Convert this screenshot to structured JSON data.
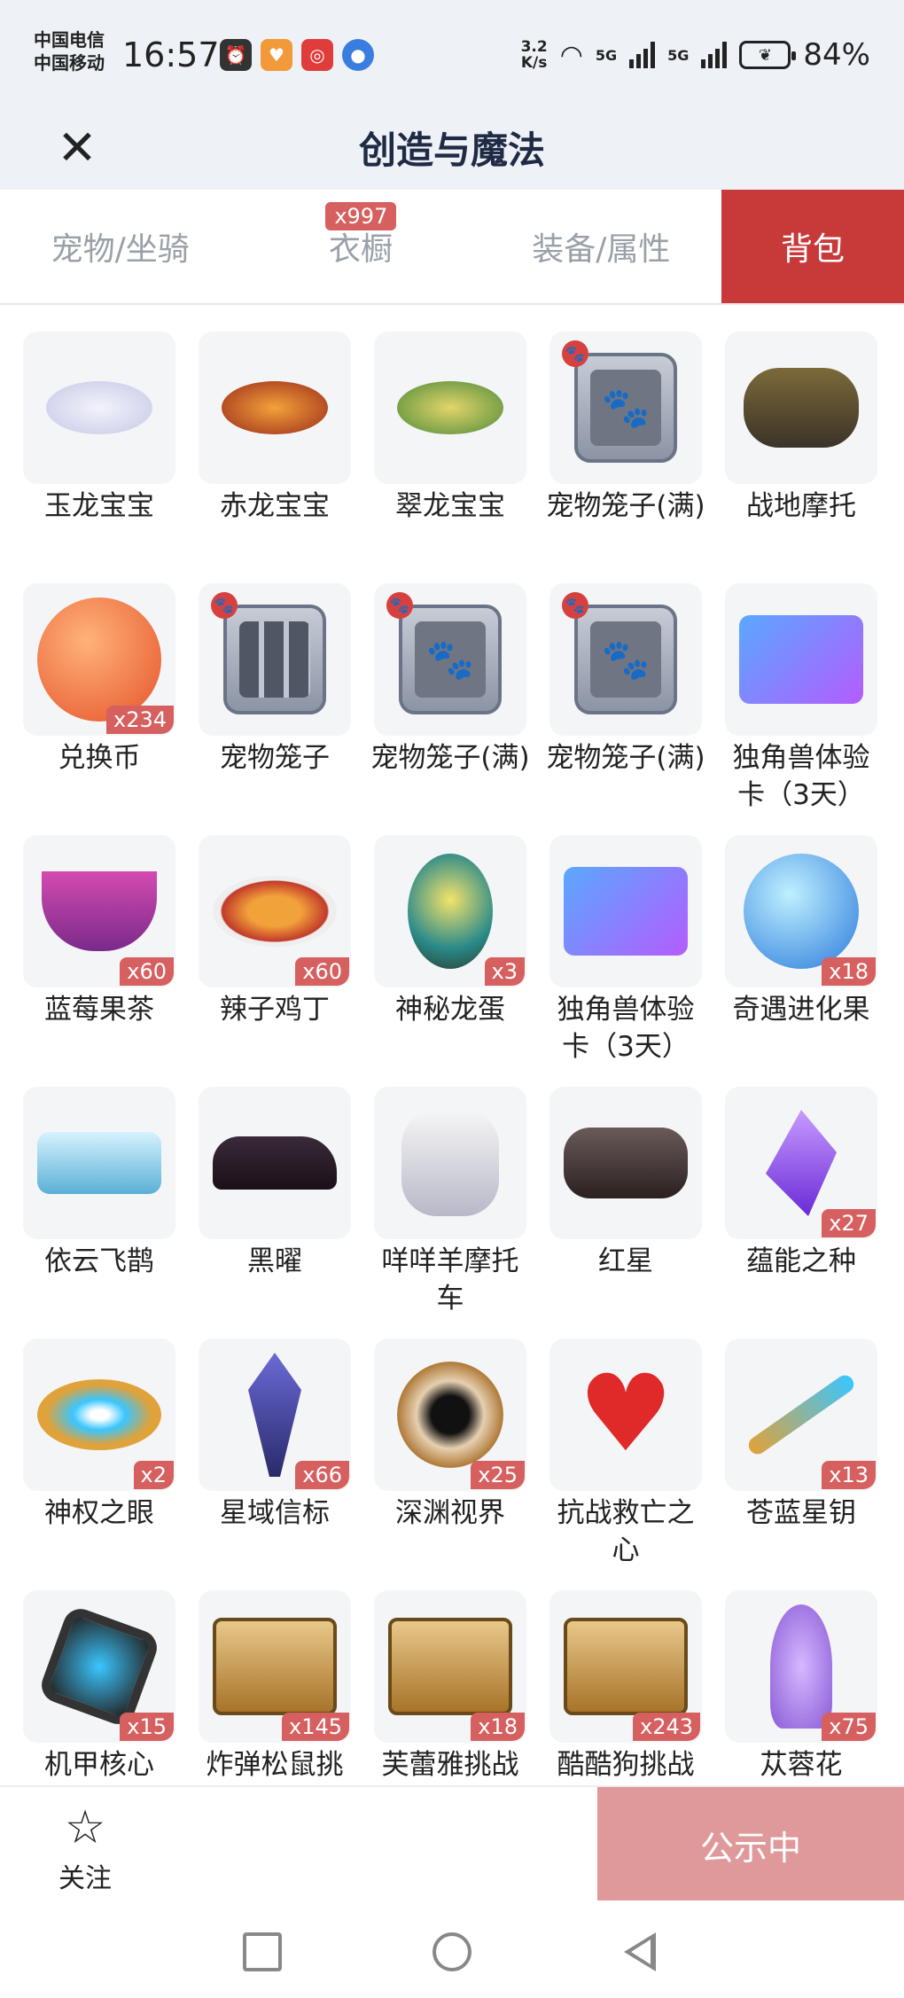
{
  "status_bar": {
    "carrier_1": "中国电信",
    "carrier_2": "中国移动",
    "time": "16:57",
    "speed_value": "3.2",
    "speed_unit": "K/s",
    "network_1": "5G",
    "network_2": "5G",
    "battery": "84%"
  },
  "header": {
    "close_icon": "close-icon",
    "title": "创造与魔法"
  },
  "tabs": [
    {
      "label": "宠物/坐骑",
      "active": false
    },
    {
      "label": "衣橱",
      "active": false,
      "badge": "x997"
    },
    {
      "label": "装备/属性",
      "active": false
    },
    {
      "label": "背包",
      "active": true
    }
  ],
  "items": [
    {
      "name": "玉龙宝宝",
      "count": "",
      "icon": "jade-dragon"
    },
    {
      "name": "赤龙宝宝",
      "count": "",
      "icon": "red-dragon"
    },
    {
      "name": "翠龙宝宝",
      "count": "",
      "icon": "green-dragon"
    },
    {
      "name": "宠物笼子(满)",
      "count": "",
      "icon": "pet-cage-full"
    },
    {
      "name": "战地摩托",
      "count": "",
      "icon": "motorcycle"
    },
    {
      "name": "兑换币",
      "count": "x234",
      "icon": "exchange-coin"
    },
    {
      "name": "宠物笼子",
      "count": "",
      "icon": "pet-cage"
    },
    {
      "name": "宠物笼子(满)",
      "count": "",
      "icon": "pet-cage-full"
    },
    {
      "name": "宠物笼子(满)",
      "count": "",
      "icon": "pet-cage-full"
    },
    {
      "name": "独角兽体验卡（3天）",
      "count": "",
      "icon": "unicorn-card"
    },
    {
      "name": "蓝莓果茶",
      "count": "x60",
      "icon": "blueberry-tea"
    },
    {
      "name": "辣子鸡丁",
      "count": "x60",
      "icon": "spicy-chicken"
    },
    {
      "name": "神秘龙蛋",
      "count": "x3",
      "icon": "dragon-egg"
    },
    {
      "name": "独角兽体验卡（3天）",
      "count": "",
      "icon": "unicorn-card"
    },
    {
      "name": "奇遇进化果",
      "count": "x18",
      "icon": "evolution-fruit"
    },
    {
      "name": "依云飞鹊",
      "count": "",
      "icon": "drone"
    },
    {
      "name": "黑曜",
      "count": "",
      "icon": "black-car"
    },
    {
      "name": "咩咩羊摩托车",
      "count": "",
      "icon": "sheep-scooter"
    },
    {
      "name": "红星",
      "count": "",
      "icon": "red-star-motorcycle"
    },
    {
      "name": "蕴能之种",
      "count": "x27",
      "icon": "crystal-seed"
    },
    {
      "name": "神权之眼",
      "count": "x2",
      "icon": "divine-eye"
    },
    {
      "name": "星域信标",
      "count": "x66",
      "icon": "star-beacon"
    },
    {
      "name": "深渊视界",
      "count": "x25",
      "icon": "abyss-sun"
    },
    {
      "name": "抗战救亡之心",
      "count": "",
      "icon": "red-heart"
    },
    {
      "name": "苍蓝星钥",
      "count": "x13",
      "icon": "star-key"
    },
    {
      "name": "机甲核心",
      "count": "x15",
      "icon": "mech-core"
    },
    {
      "name": "炸弹松鼠挑",
      "count": "x145",
      "icon": "wanted-scroll"
    },
    {
      "name": "芙蕾雅挑战",
      "count": "x18",
      "icon": "wanted-scroll"
    },
    {
      "name": "酷酷狗挑战",
      "count": "x243",
      "icon": "wanted-scroll"
    },
    {
      "name": "苁蓉花",
      "count": "x75",
      "icon": "lilac-flower"
    }
  ],
  "bottom": {
    "follow_label": "关注",
    "publish_label": "公示中"
  },
  "colors": {
    "accent": "#c83a3a",
    "badge": "#d66060",
    "publish_bg": "#e0999a",
    "header_bg": "#eef2f7"
  }
}
